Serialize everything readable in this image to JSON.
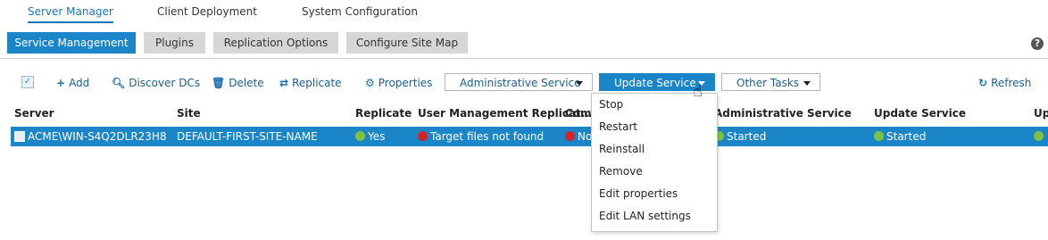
{
  "topnav": {
    "server_manager": "Server Manager",
    "client_deployment": "Client Deployment",
    "system_configuration": "System Configuration"
  },
  "tabs": {
    "service_management": "Service Management",
    "plugins": "Plugins",
    "replication_options": "Replication Options",
    "configure_site_map": "Configure Site Map"
  },
  "help_label": "?",
  "toolbar": {
    "add": "Add",
    "discover_dcs": "Discover DCs",
    "delete": "Delete",
    "replicate": "Replicate",
    "properties": "Properties",
    "administrative_service": "Administrative Service",
    "update_service": "Update Service",
    "other_tasks": "Other Tasks",
    "refresh": "Refresh"
  },
  "table": {
    "headers": {
      "server": "Server",
      "site": "Site",
      "replicate": "Replicate",
      "user_mgmt": "User Management Replicat...",
      "comp": "Comp",
      "admin_service": "Administrative Service",
      "update_service": "Update Service",
      "up": "Up"
    },
    "row": {
      "server": "ACME\\WIN-S4Q2DLR23H8",
      "site": "DEFAULT-FIRST-SITE-NAME",
      "replicate": "Yes",
      "user_mgmt": "Target files not found",
      "comp": "No",
      "admin_service": "Started",
      "update_service": "Started"
    }
  },
  "menu": {
    "items": [
      "Stop",
      "Restart",
      "Reinstall",
      "Remove",
      "Edit properties",
      "Edit LAN settings"
    ]
  },
  "colors": {
    "accent": "#1b86c7",
    "status_green": "#7dc242",
    "status_red": "#d2232a"
  }
}
